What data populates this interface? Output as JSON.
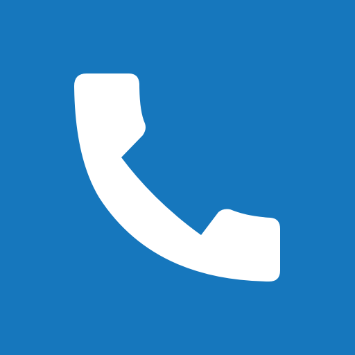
{
  "icon": {
    "name": "phone-icon",
    "background_color": "#1677BD",
    "glyph_color": "#FFFFFF"
  }
}
